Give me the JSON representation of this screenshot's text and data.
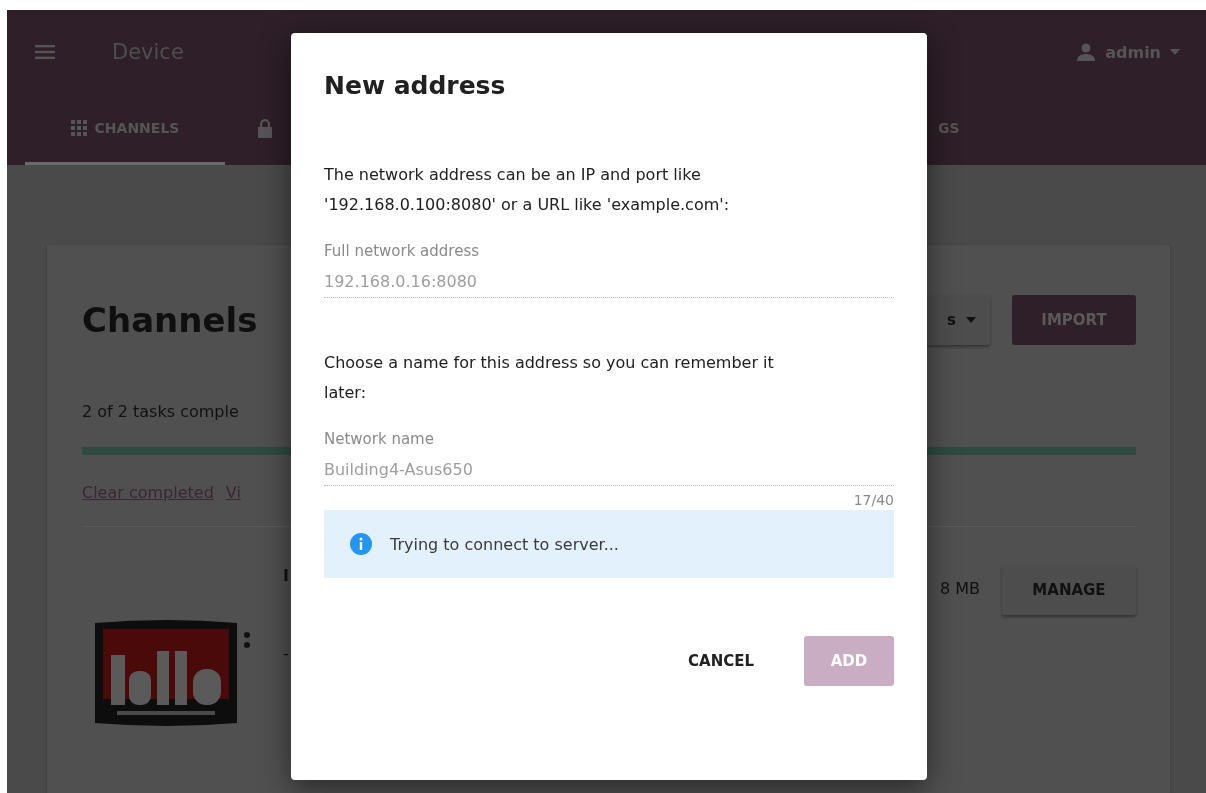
{
  "header": {
    "title": "Device",
    "user": "admin"
  },
  "tabs": [
    {
      "kind": "labelled",
      "label": "CHANNELS",
      "selected": true
    },
    {
      "kind": "icon-only",
      "selected": false
    },
    {
      "kind": "labelled",
      "label": "GS",
      "selected": false
    }
  ],
  "card": {
    "title": "Channels",
    "task_summary": "2 of 2 tasks comple",
    "progress": {
      "level": 1
    },
    "links": [
      "Clear completed",
      "Vi"
    ],
    "toolbar": {
      "dropdown": "s",
      "import": "IMPORT"
    },
    "channel_row": {
      "fragments": [
        "I",
        "-"
      ],
      "size": "8 MB",
      "manage": "MANAGE"
    }
  },
  "dialog": {
    "title": "New address",
    "prompt_address": "The network address can be an IP and port like '192.168.0.100:8080' or a URL like 'example.com':",
    "address_field": {
      "label": "Full network address",
      "value": "192.168.0.16:8080",
      "disabled": true
    },
    "prompt_name": "Choose a name for this address so you can remember it later:",
    "name_field": {
      "label": "Network name",
      "value": "Building4-Asus650",
      "counter": "17/40",
      "disabled": true
    },
    "info": "Trying to connect to server...",
    "cancel": "CANCEL",
    "add": {
      "label": "ADD",
      "disabled": true
    }
  }
}
